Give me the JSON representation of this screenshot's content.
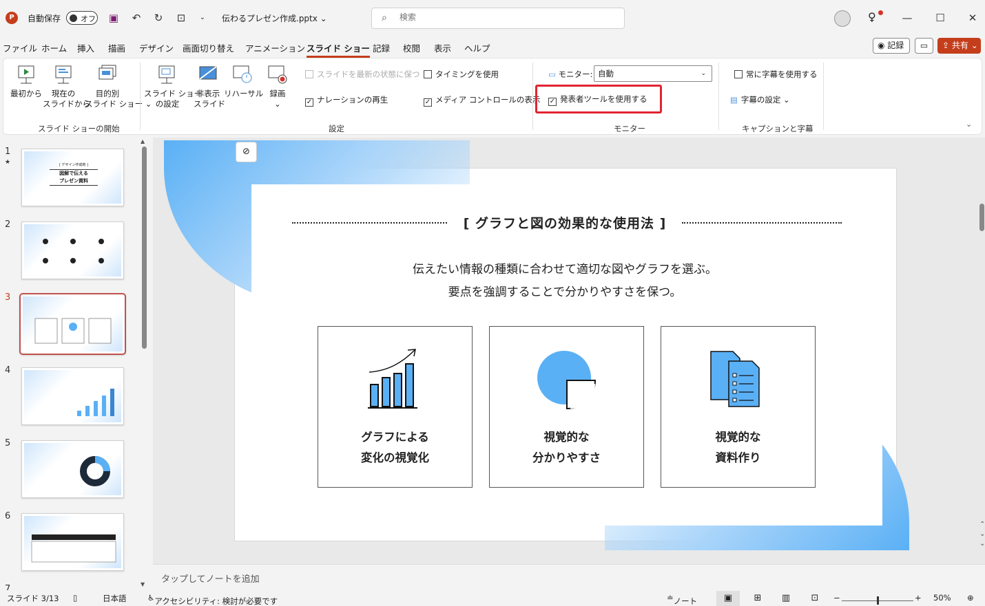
{
  "titlebar": {
    "autosave_label": "自動保存",
    "autosave_state": "オフ",
    "filename": "伝わるプレゼン作成.pptx",
    "search_placeholder": "検索"
  },
  "menu": {
    "tabs": [
      "ファイル",
      "ホーム",
      "挿入",
      "描画",
      "デザイン",
      "画面切り替え",
      "アニメーション",
      "スライド ショー",
      "記録",
      "校閲",
      "表示",
      "ヘルプ"
    ],
    "active_tab": "スライド ショー",
    "record_label": "記録",
    "share_label": "共有"
  },
  "ribbon": {
    "start_group": {
      "label": "スライド ショーの開始",
      "from_beginning": "最初から",
      "from_current_1": "現在の",
      "from_current_2": "スライドから",
      "custom_1": "目的別",
      "custom_2": "スライド ショー"
    },
    "setup_group": {
      "label": "設定",
      "setup_1": "スライド ショー",
      "setup_2": "の設定",
      "hide_1": "非表示",
      "hide_2": "スライド",
      "rehearse": "リハーサル",
      "record": "録画",
      "keep_updated": "スライドを最新の状態に保つ",
      "play_narrations": "ナレーションの再生",
      "use_timings": "タイミングを使用",
      "show_media_controls": "メディア コントロールの表示"
    },
    "monitors_group": {
      "label": "モニター",
      "monitor_label": "モニター:",
      "monitor_value": "自動",
      "presenter_view": "発表者ツールを使用する"
    },
    "captions_group": {
      "label": "キャプションと字幕",
      "always_subtitles": "常に字幕を使用する",
      "subtitle_settings": "字幕の設定"
    }
  },
  "thumbnails": [
    {
      "num": "1",
      "mark": "★",
      "title_1": "[ デザイン作成術 ]",
      "title_2": "図解で伝える",
      "title_3": "プレゼン資料"
    },
    {
      "num": "2"
    },
    {
      "num": "3"
    },
    {
      "num": "4"
    },
    {
      "num": "5"
    },
    {
      "num": "6"
    },
    {
      "num": "7"
    }
  ],
  "slide": {
    "title": "[ グラフと図の効果的な使用法 ]",
    "subtitle_1": "伝えたい情報の種類に合わせて適切な図やグラフを選ぶ。",
    "subtitle_2": "要点を強調することで分かりやすさを保つ。",
    "cards": [
      {
        "line1": "グラフによる",
        "line2": "変化の視覚化",
        "icon": "bar-chart-rising-icon"
      },
      {
        "line1": "視覚的な",
        "line2": "分かりやすさ",
        "icon": "pie-chart-icon"
      },
      {
        "line1": "視覚的な",
        "line2": "資料作り",
        "icon": "documents-icon"
      }
    ]
  },
  "notes_placeholder": "タップしてノートを追加",
  "status": {
    "slide_info": "スライド 3/13",
    "language": "日本語",
    "accessibility": "アクセシビリティ: 検討が必要です",
    "notes": "ノート",
    "zoom": "50%"
  },
  "colors": {
    "accent": "#c43e1c",
    "highlight": "#e0242f",
    "slide_blue": "#5ab0f5"
  }
}
